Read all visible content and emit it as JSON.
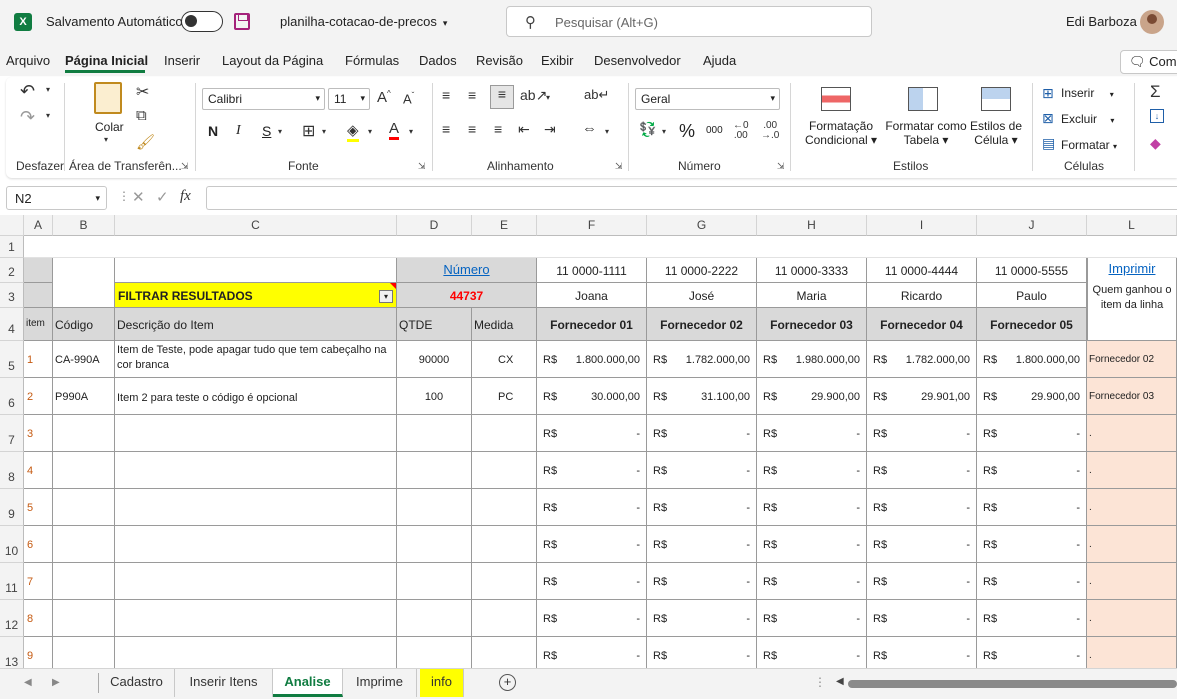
{
  "titlebar": {
    "autosave_label": "Salvamento Automático",
    "autosave_state": "Desativado",
    "filename": "planilha-cotacao-de-precos",
    "search_placeholder": "Pesquisar (Alt+G)",
    "user_name": "Edi Barboza"
  },
  "menu": {
    "items": [
      "Arquivo",
      "Página Inicial",
      "Inserir",
      "Layout da Página",
      "Fórmulas",
      "Dados",
      "Revisão",
      "Exibir",
      "Desenvolvedor",
      "Ajuda"
    ],
    "active": "Página Inicial",
    "comments": "Come"
  },
  "ribbon": {
    "undo_group": "Desfazer",
    "clipboard": {
      "paste": "Colar",
      "group": "Área de Transferên..."
    },
    "font": {
      "name": "Calibri",
      "size": "11",
      "bold": "N",
      "italic": "I",
      "underline": "S",
      "group": "Fonte"
    },
    "alignment": {
      "group": "Alinhamento"
    },
    "number": {
      "format": "Geral",
      "percent": "%",
      "thousands": "000",
      "group": "Número"
    },
    "styles": {
      "conditional_1": "Formatação",
      "conditional_2": "Condicional",
      "table_1": "Formatar como",
      "table_2": "Tabela",
      "cell_1": "Estilos de",
      "cell_2": "Célula",
      "group": "Estilos"
    },
    "cells": {
      "insert": "Inserir",
      "delete": "Excluir",
      "format": "Formatar",
      "group": "Células"
    }
  },
  "formula_bar": {
    "name_box": "N2",
    "fx": "fx",
    "value": ""
  },
  "columns": [
    "A",
    "B",
    "C",
    "D",
    "E",
    "F",
    "G",
    "H",
    "I",
    "J",
    "L"
  ],
  "rows": [
    "1",
    "2",
    "3",
    "4",
    "5",
    "6",
    "7",
    "8",
    "9",
    "10",
    "11",
    "12",
    "13"
  ],
  "sheet": {
    "numero_label": "Número",
    "numero_value": "44737",
    "filter_label": "FILTRAR RESULTADOS",
    "print_link": "Imprimir",
    "winner_header": "Quem ganhou o item da linha",
    "headers": {
      "item": "item",
      "code": "Código",
      "desc": "Descrição do Item",
      "qty": "QTDE",
      "unit": "Medida"
    },
    "currency": "R$",
    "suppliers": [
      {
        "phone": "11 0000-1111",
        "name": "Joana",
        "label": "Fornecedor 01"
      },
      {
        "phone": "11 0000-2222",
        "name": "José",
        "label": "Fornecedor 02"
      },
      {
        "phone": "11 0000-3333",
        "name": "Maria",
        "label": "Fornecedor 03"
      },
      {
        "phone": "11 0000-4444",
        "name": "Ricardo",
        "label": "Fornecedor 04"
      },
      {
        "phone": "11 0000-5555",
        "name": "Paulo",
        "label": "Fornecedor 05"
      }
    ],
    "items": [
      {
        "item": "1",
        "code": "CA-990A",
        "desc": "Item de Teste, pode apagar tudo que tem cabeçalho na cor branca",
        "qty": "90000",
        "unit": "CX",
        "prices": [
          "1.800.000,00",
          "1.782.000,00",
          "1.980.000,00",
          "1.782.000,00",
          "1.800.000,00"
        ],
        "winner": "Fornecedor 02"
      },
      {
        "item": "2",
        "code": "P990A",
        "desc": "Item 2 para teste o código é opcional",
        "qty": "100",
        "unit": "PC",
        "prices": [
          "30.000,00",
          "31.100,00",
          "29.900,00",
          "29.901,00",
          "29.900,00"
        ],
        "winner": "Fornecedor 03"
      },
      {
        "item": "3",
        "code": "",
        "desc": "",
        "qty": "",
        "unit": "",
        "prices": [
          "-",
          "-",
          "-",
          "-",
          "-"
        ],
        "winner": "."
      },
      {
        "item": "4",
        "code": "",
        "desc": "",
        "qty": "",
        "unit": "",
        "prices": [
          "-",
          "-",
          "-",
          "-",
          "-"
        ],
        "winner": "."
      },
      {
        "item": "5",
        "code": "",
        "desc": "",
        "qty": "",
        "unit": "",
        "prices": [
          "-",
          "-",
          "-",
          "-",
          "-"
        ],
        "winner": "."
      },
      {
        "item": "6",
        "code": "",
        "desc": "",
        "qty": "",
        "unit": "",
        "prices": [
          "-",
          "-",
          "-",
          "-",
          "-"
        ],
        "winner": "."
      },
      {
        "item": "7",
        "code": "",
        "desc": "",
        "qty": "",
        "unit": "",
        "prices": [
          "-",
          "-",
          "-",
          "-",
          "-"
        ],
        "winner": "."
      },
      {
        "item": "8",
        "code": "",
        "desc": "",
        "qty": "",
        "unit": "",
        "prices": [
          "-",
          "-",
          "-",
          "-",
          "-"
        ],
        "winner": "."
      },
      {
        "item": "9",
        "code": "",
        "desc": "",
        "qty": "",
        "unit": "",
        "prices": [
          "-",
          "-",
          "-",
          "-",
          "-"
        ],
        "winner": "."
      }
    ]
  },
  "tabs": [
    {
      "label": "Cadastro",
      "active": false
    },
    {
      "label": "Inserir Itens",
      "active": false
    },
    {
      "label": "Analise",
      "active": true
    },
    {
      "label": "Imprime",
      "active": false
    },
    {
      "label": "info",
      "active": false,
      "color": "#ffff00"
    }
  ],
  "colors": {
    "excel_green": "#107c41",
    "accent_pink": "#a4217a",
    "header_gray": "#d9d9d9",
    "winner_fill": "#fce4d6",
    "filter_fill": "#ffff00",
    "number_red": "#ff0000",
    "link_blue": "#0563c1"
  }
}
